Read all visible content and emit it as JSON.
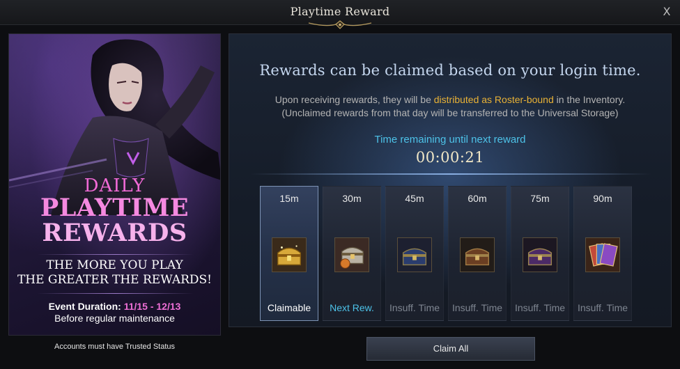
{
  "window": {
    "title": "Playtime Reward",
    "close_label": "X"
  },
  "banner": {
    "line1": "DAILY",
    "line2": "PLAYTIME",
    "line3": "REWARDS",
    "sub1": "THE MORE YOU PLAY",
    "sub2": "THE GREATER THE REWARDS!",
    "event_label": "Event Duration: ",
    "event_dates": "11/15 - 12/13",
    "maintenance": "Before regular maintenance",
    "trusted_note": "Accounts must have Trusted Status"
  },
  "main": {
    "headline": "Rewards can be claimed based on your login time.",
    "info_prefix": "Upon receiving rewards, they will be ",
    "info_highlight": "distributed as Roster-bound",
    "info_suffix": " in the Inventory.",
    "info_line2": "(Unclaimed rewards from that day will be transferred to the Universal Storage)",
    "timer_label": "Time remaining until next reward",
    "timer_value": "00:00:21"
  },
  "slots": [
    {
      "time": "15m",
      "status": "Claimable",
      "icon": "gold-chest-icon"
    },
    {
      "time": "30m",
      "status": "Next Rew.",
      "icon": "silver-chest-icon"
    },
    {
      "time": "45m",
      "status": "Insuff. Time",
      "icon": "blue-chest-icon"
    },
    {
      "time": "60m",
      "status": "Insuff. Time",
      "icon": "bronze-chest-icon"
    },
    {
      "time": "75m",
      "status": "Insuff. Time",
      "icon": "purple-chest-icon"
    },
    {
      "time": "90m",
      "status": "Insuff. Time",
      "icon": "card-pack-icon"
    }
  ],
  "claim_all_label": "Claim All",
  "colors": {
    "accent_blue": "#4dc2e8",
    "highlight_gold": "#e9b236",
    "event_pink": "#ee6fd6"
  }
}
